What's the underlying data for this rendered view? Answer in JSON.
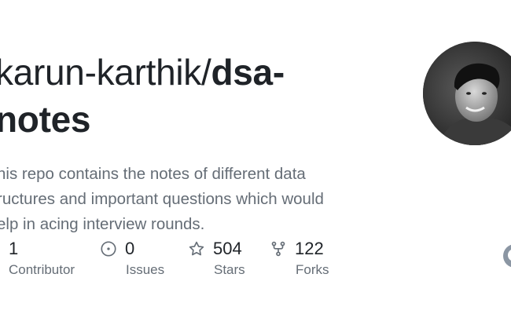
{
  "repo": {
    "owner_prefix": "karun-karthik/",
    "name_part1": "dsa-",
    "name_part2": "notes"
  },
  "description": {
    "lines": [
      "his repo contains the notes of different data",
      "ructures and important questions which would",
      "elp in acing interview rounds."
    ]
  },
  "stats": [
    {
      "value": "1",
      "label": "Contributor",
      "icon": "people-icon"
    },
    {
      "value": "0",
      "label": "Issues",
      "icon": "issue-icon"
    },
    {
      "value": "504",
      "label": "Stars",
      "icon": "star-icon"
    },
    {
      "value": "122",
      "label": "Forks",
      "icon": "fork-icon"
    }
  ],
  "colors": {
    "text": "#1f2328",
    "muted": "#656d76",
    "background": "#ffffff"
  }
}
